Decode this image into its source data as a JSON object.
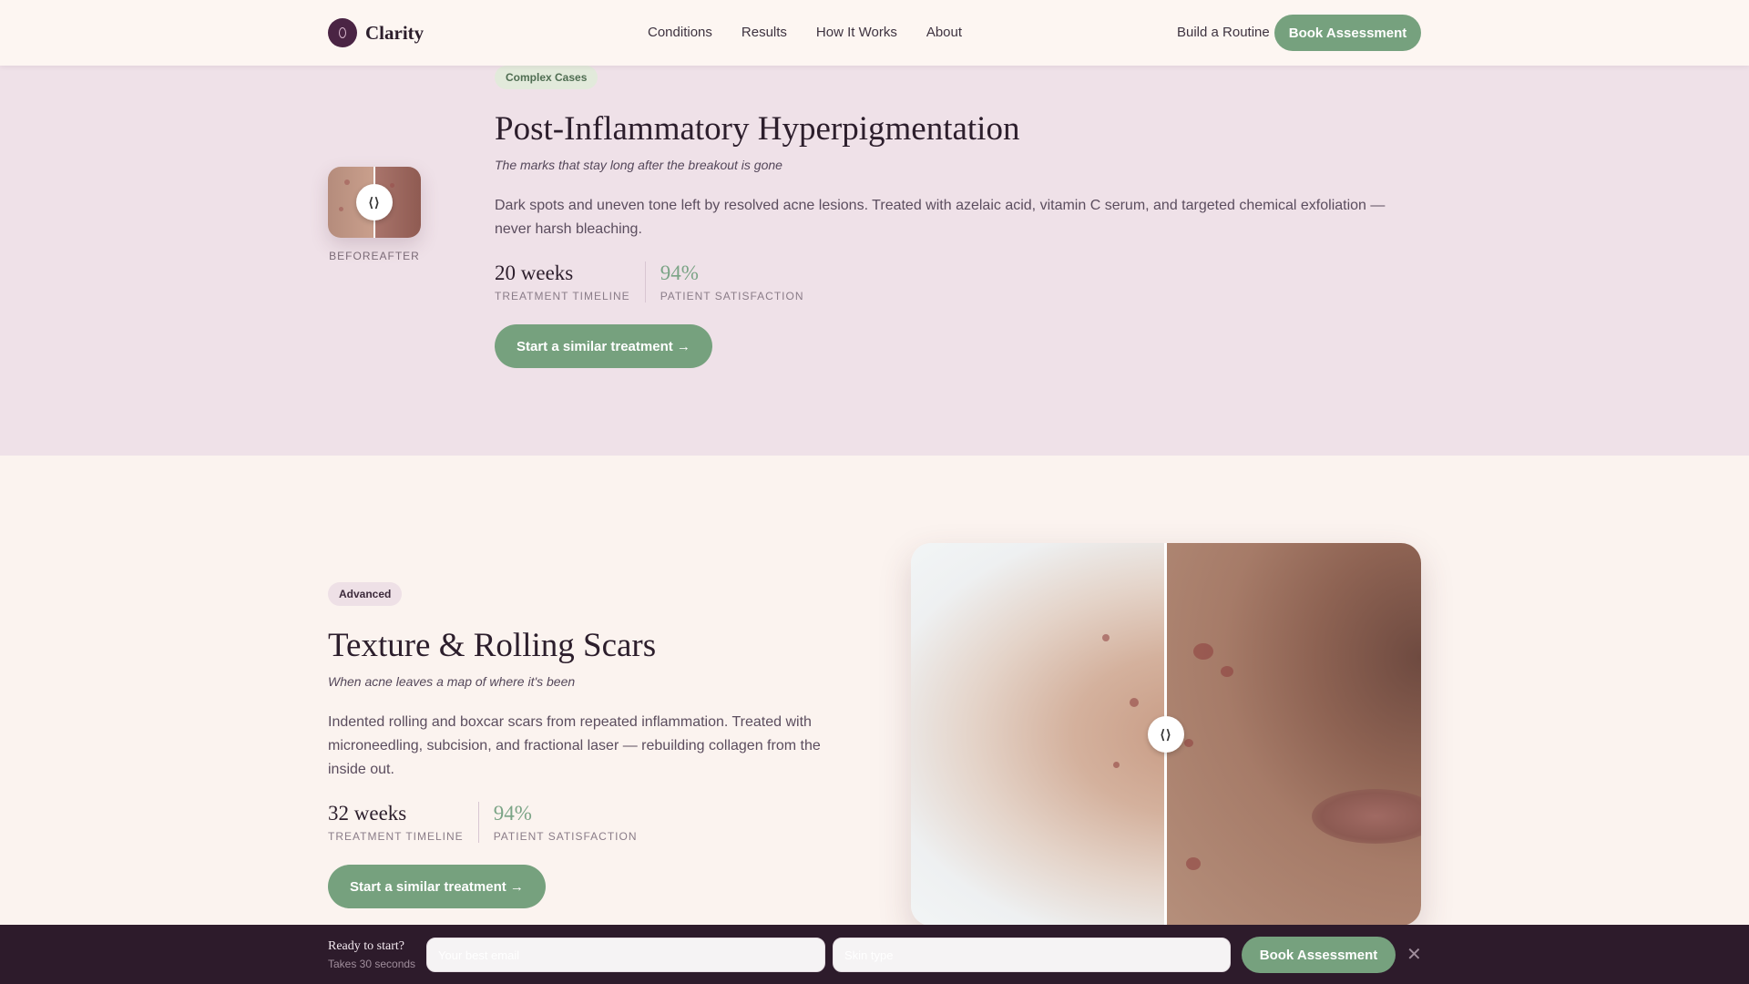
{
  "header": {
    "brand": "Clarity",
    "nav": [
      "Conditions",
      "Results",
      "How It Works",
      "About"
    ],
    "routine_link": "Build a Routine",
    "book_button": "Book Assessment"
  },
  "case1": {
    "badge": "Complex Cases",
    "title": "Post-Inflammatory Hyperpigmentation",
    "subtitle": "The marks that stay long after the breakout is gone",
    "description": "Dark spots and uneven tone left by resolved acne lesions. Treated with azelaic acid, vitamin C serum, and targeted chemical exfoliation — never harsh bleaching.",
    "thumb_label_before": "BEFORE",
    "thumb_label_after": "AFTER",
    "stats": [
      {
        "value": "20 weeks",
        "label": "TREATMENT TIMELINE"
      },
      {
        "value": "94%",
        "label": "PATIENT SATISFACTION"
      }
    ],
    "cta": "Start a similar treatment →"
  },
  "case2": {
    "badge": "Advanced",
    "title": "Texture & Rolling Scars",
    "subtitle": "When acne leaves a map of where it's been",
    "description": "Indented rolling and boxcar scars from repeated inflammation. Treated with microneedling, subcision, and fractional laser — rebuilding collagen from the inside out.",
    "stats": [
      {
        "value": "32 weeks",
        "label": "TREATMENT TIMELINE"
      },
      {
        "value": "94%",
        "label": "PATIENT SATISFACTION"
      }
    ],
    "cta": "Start a similar treatment →"
  },
  "slider_handle_glyph": "⟨⟩",
  "bottom_bar": {
    "title": "Ready to start?",
    "subtitle": "Takes 30 seconds",
    "email_placeholder": "Your best email",
    "skin_placeholder": "Skin type",
    "book_button": "Book Assessment",
    "close_glyph": "✕"
  },
  "colors": {
    "accent_green": "#76a17e",
    "brand_plum": "#4a2444",
    "section_pink": "#efe1e8",
    "bar_dark": "#2d1b2b"
  }
}
